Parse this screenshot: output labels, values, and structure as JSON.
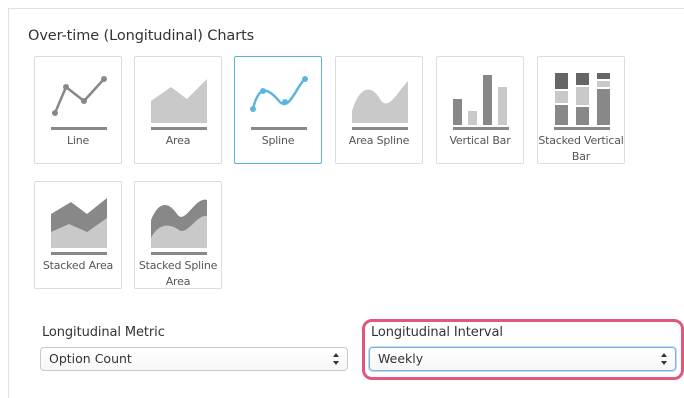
{
  "section": {
    "title": "Over-time (Longitudinal) Charts"
  },
  "chart_types": [
    {
      "label": "Line",
      "icon": "line-chart-icon",
      "selected": false
    },
    {
      "label": "Area",
      "icon": "area-chart-icon",
      "selected": false
    },
    {
      "label": "Spline",
      "icon": "spline-chart-icon",
      "selected": true
    },
    {
      "label": "Area Spline",
      "icon": "area-spline-chart-icon",
      "selected": false
    },
    {
      "label": "Vertical Bar",
      "icon": "vertical-bar-chart-icon",
      "selected": false
    },
    {
      "label": "Stacked Vertical Bar",
      "icon": "stacked-vertical-bar-chart-icon",
      "selected": false
    },
    {
      "label": "Stacked Area",
      "icon": "stacked-area-chart-icon",
      "selected": false
    },
    {
      "label": "Stacked Spline Area",
      "icon": "stacked-spline-area-chart-icon",
      "selected": false
    }
  ],
  "metric": {
    "label": "Longitudinal Metric",
    "value": "Option Count"
  },
  "interval": {
    "label": "Longitudinal Interval",
    "value": "Weekly"
  },
  "colors": {
    "icon_gray": "#aaaaaa",
    "icon_dark": "#888888",
    "icon_mid": "#bdbdbd",
    "spline_blue": "#5bb6dd",
    "selected_border": "#5bb6dd",
    "highlight": "#e0577e"
  }
}
